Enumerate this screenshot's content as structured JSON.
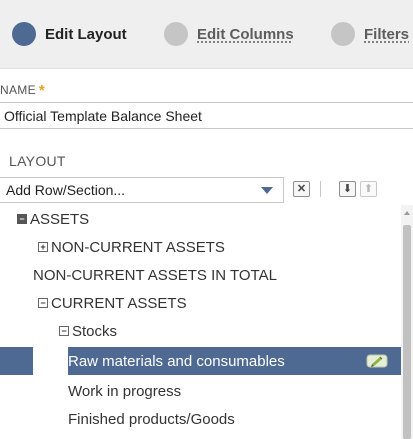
{
  "steps": [
    {
      "label": "Edit Layout",
      "state": "active"
    },
    {
      "label": "Edit Columns",
      "state": "link"
    },
    {
      "label": "Filters",
      "state": "link"
    }
  ],
  "name_field": {
    "label": "NAME",
    "required_mark": "*",
    "value": "Official Template Balance Sheet"
  },
  "layout": {
    "label": "LAYOUT",
    "add_select_value": "Add Row/Section...",
    "toolbar": {
      "remove_glyph": "✕",
      "move_down_glyph": "⬇",
      "move_up_glyph": "⬆"
    }
  },
  "tree": [
    {
      "label": "ASSETS",
      "toggle": "−",
      "state": "expanded"
    },
    {
      "label": "NON-CURRENT ASSETS",
      "toggle": "+",
      "state": "collapsed"
    },
    {
      "label": "NON-CURRENT ASSETS IN TOTAL",
      "toggle": "",
      "state": "leaf"
    },
    {
      "label": "CURRENT ASSETS",
      "toggle": "−",
      "state": "expanded"
    },
    {
      "label": "Stocks",
      "toggle": "−",
      "state": "expanded"
    },
    {
      "label": "Raw materials and consumables",
      "toggle": "",
      "state": "selected",
      "icon": "edit-pencil-icon"
    },
    {
      "label": "Work in progress",
      "toggle": "",
      "state": "leaf"
    },
    {
      "label": "Finished products/Goods",
      "toggle": "",
      "state": "leaf"
    }
  ],
  "colors": {
    "accent": "#4e6a92",
    "required": "#e6a21d",
    "inactive_step": "#c5c5c5"
  }
}
